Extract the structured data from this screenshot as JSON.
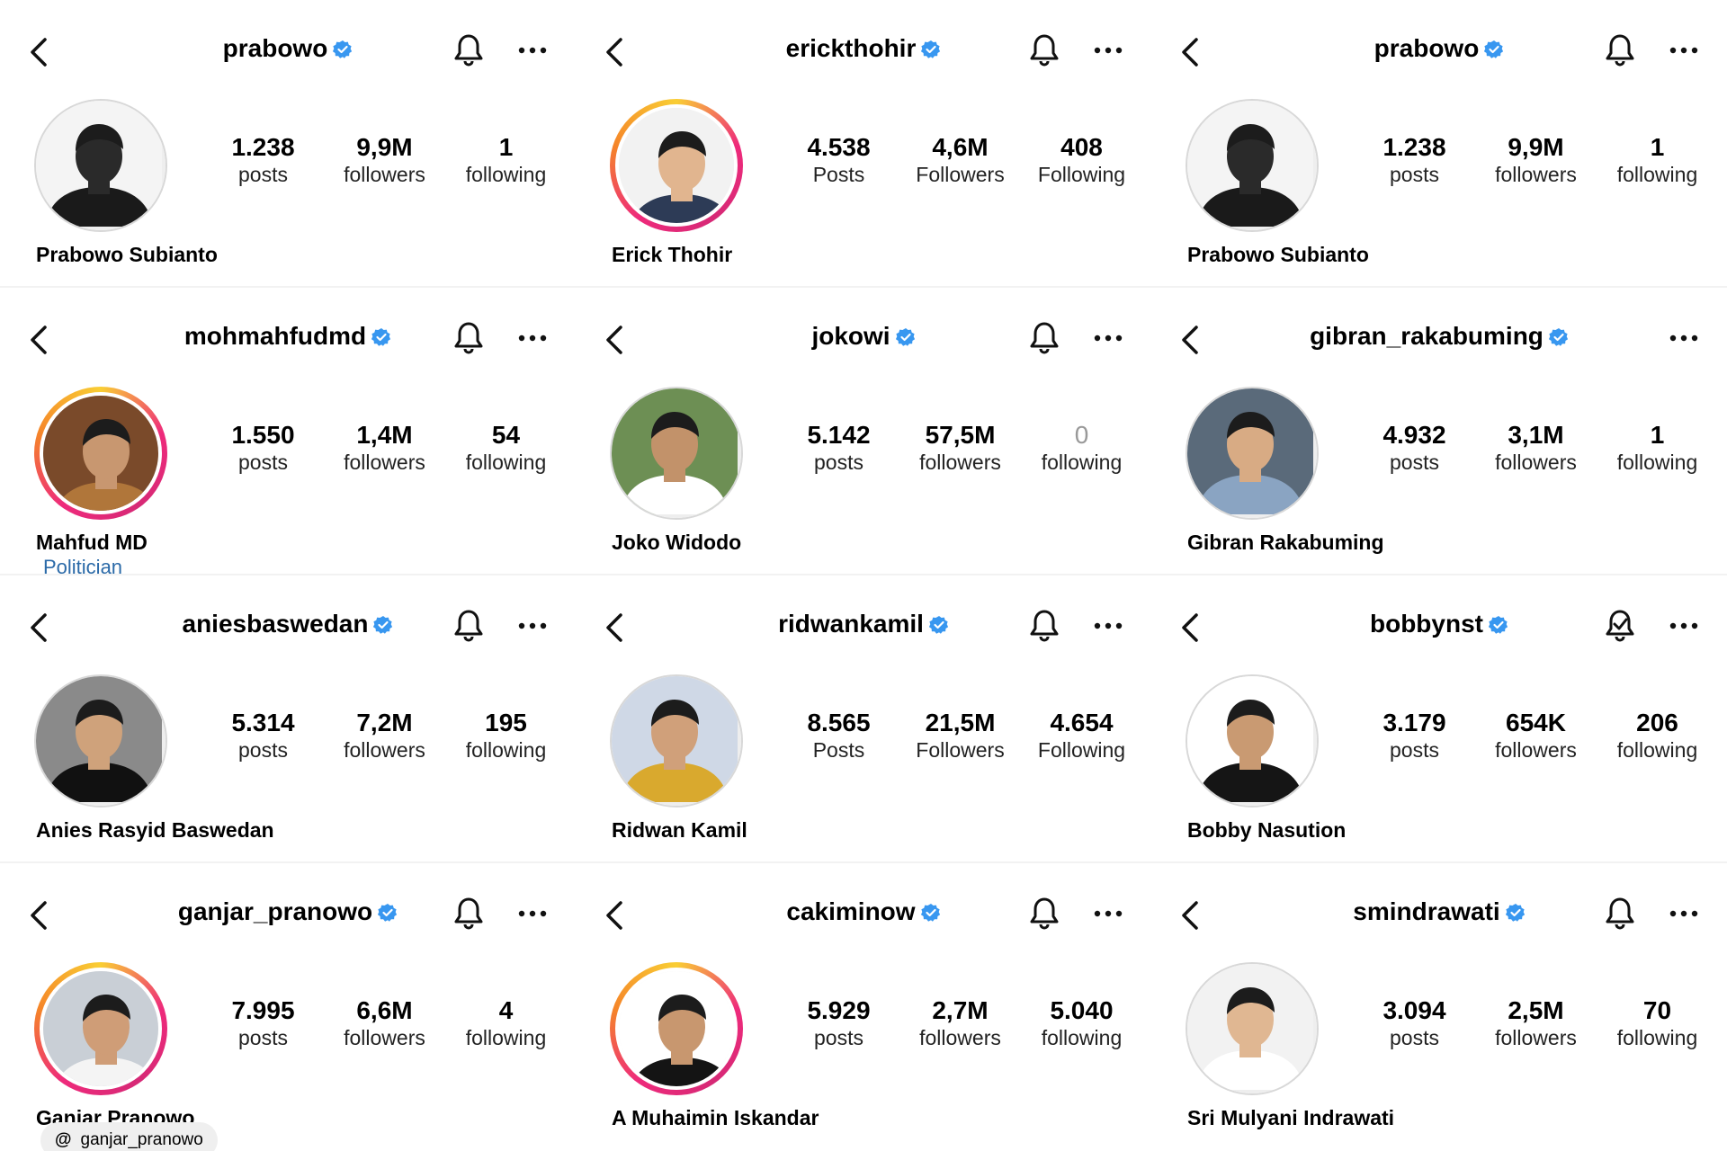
{
  "cards": [
    {
      "username": "prabowo",
      "full_name": "Prabowo Subianto",
      "posts": "1.238",
      "posts_label": "posts",
      "followers": "9,9M",
      "followers_label": "followers",
      "following": "1",
      "following_label": "following",
      "ring": false,
      "avatar_bg": "#f4f4f4",
      "skin": "#2a2a2a",
      "suit": "#1a1a1a",
      "bell": "bell-icon"
    },
    {
      "username": "erickthohir",
      "full_name": "Erick Thohir",
      "posts": "4.538",
      "posts_label": "Posts",
      "followers": "4,6M",
      "followers_label": "Followers",
      "following": "408",
      "following_label": "Following",
      "ring": true,
      "avatar_bg": "#f2f2f2",
      "skin": "#e1b58f",
      "suit": "#2d3b56",
      "bell": "bell-icon"
    },
    {
      "username": "prabowo",
      "full_name": "Prabowo Subianto",
      "posts": "1.238",
      "posts_label": "posts",
      "followers": "9,9M",
      "followers_label": "followers",
      "following": "1",
      "following_label": "following",
      "ring": false,
      "avatar_bg": "#f4f4f4",
      "skin": "#2a2a2a",
      "suit": "#1a1a1a",
      "bell": "bell-icon"
    },
    {
      "username": "mohmahfudmd",
      "full_name": "Mahfud MD",
      "category": "Politician",
      "posts": "1.550",
      "posts_label": "posts",
      "followers": "1,4M",
      "followers_label": "followers",
      "following": "54",
      "following_label": "following",
      "ring": true,
      "avatar_bg": "#7a4a2a",
      "skin": "#c89770",
      "suit": "#b0763a",
      "bell": "bell-icon"
    },
    {
      "username": "jokowi",
      "full_name": "Joko Widodo",
      "posts": "5.142",
      "posts_label": "posts",
      "followers": "57,5M",
      "followers_label": "followers",
      "following": "0",
      "following_label": "following",
      "ring": false,
      "avatar_bg": "#6d8f54",
      "skin": "#c2926a",
      "suit": "#ffffff",
      "bell": "bell-icon"
    },
    {
      "username": "gibran_rakabuming",
      "full_name": "Gibran Rakabuming",
      "posts": "4.932",
      "posts_label": "posts",
      "followers": "3,1M",
      "followers_label": "followers",
      "following": "1",
      "following_label": "following",
      "ring": false,
      "avatar_bg": "#5a6a7a",
      "skin": "#d8ab84",
      "suit": "#8aa4c2",
      "bell": ""
    },
    {
      "username": "aniesbaswedan",
      "full_name": "Anies Rasyid Baswedan",
      "posts": "5.314",
      "posts_label": "posts",
      "followers": "7,2M",
      "followers_label": "followers",
      "following": "195",
      "following_label": "following",
      "ring": false,
      "avatar_bg": "#8a8a8a",
      "skin": "#cfa27b",
      "suit": "#111111",
      "bell": "bell-icon"
    },
    {
      "username": "ridwankamil",
      "full_name": "Ridwan Kamil",
      "posts": "8.565",
      "posts_label": "Posts",
      "followers": "21,5M",
      "followers_label": "Followers",
      "following": "4.654",
      "following_label": "Following",
      "ring": false,
      "avatar_bg": "#cfd8e6",
      "skin": "#d0a07a",
      "suit": "#d9a92e",
      "bell": "bell-icon"
    },
    {
      "username": "bobbynst",
      "full_name": "Bobby Nasution",
      "posts": "3.179",
      "posts_label": "posts",
      "followers": "654K",
      "followers_label": "followers",
      "following": "206",
      "following_label": "following",
      "ring": false,
      "avatar_bg": "#ffffff",
      "skin": "#c99a72",
      "suit": "#151515",
      "bell": "bell-check-icon"
    },
    {
      "username": "ganjar_pranowo",
      "full_name": "Ganjar Pranowo",
      "threads_handle": "ganjar_pranowo",
      "posts": "7.995",
      "posts_label": "posts",
      "followers": "6,6M",
      "followers_label": "followers",
      "following": "4",
      "following_label": "following",
      "ring": true,
      "avatar_bg": "#c9cfd6",
      "skin": "#cf9d77",
      "suit": "#f4f4f4",
      "bell": "bell-icon"
    },
    {
      "username": "cakiminow",
      "full_name": "A Muhaimin Iskandar",
      "posts": "5.929",
      "posts_label": "posts",
      "followers": "2,7M",
      "followers_label": "followers",
      "following": "5.040",
      "following_label": "following",
      "ring": true,
      "avatar_bg": "#ffffff",
      "skin": "#c8976f",
      "suit": "#141414",
      "bell": "bell-icon"
    },
    {
      "username": "smindrawati",
      "full_name": "Sri Mulyani Indrawati",
      "posts": "3.094",
      "posts_label": "posts",
      "followers": "2,5M",
      "followers_label": "followers",
      "following": "70",
      "following_label": "following",
      "ring": false,
      "avatar_bg": "#f2f2f2",
      "skin": "#e0b792",
      "suit": "#ffffff",
      "bell": "bell-icon"
    }
  ],
  "colors": {
    "verified": "#3897f0",
    "ring_start": "#f9ce34",
    "ring_end": "#ee2a7b",
    "dim_text": "#999999",
    "category": "#2b6aa8"
  }
}
